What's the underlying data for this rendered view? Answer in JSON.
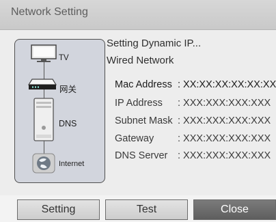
{
  "window": {
    "title": "Network Setting"
  },
  "devices": [
    {
      "label": "TV",
      "icon": "tv-icon"
    },
    {
      "label": "网关",
      "icon": "gateway-icon"
    },
    {
      "label": "DNS",
      "icon": "server-icon"
    },
    {
      "label": "Internet",
      "icon": "globe-icon"
    }
  ],
  "status": {
    "line1": "Setting Dynamic IP...",
    "line2": "Wired Network"
  },
  "info": [
    {
      "label": "Mac Address",
      "value": ": XX:XX:XX:XX:XX:XX"
    },
    {
      "label": "IP Address",
      "value": ": XXX:XXX:XXX:XXX"
    },
    {
      "label": "Subnet Mask",
      "value": ": XXX:XXX:XXX:XXX"
    },
    {
      "label": "Gateway",
      "value": ": XXX:XXX:XXX:XXX"
    },
    {
      "label": "DNS Server",
      "value": ": XXX:XXX:XXX:XXX"
    }
  ],
  "buttons": {
    "setting": "Setting",
    "test": "Test",
    "close": "Close"
  },
  "colors": {
    "active_button": "#6b6b6b",
    "panel": "#d2d5dd",
    "titlebar": "#d0d0d0"
  }
}
